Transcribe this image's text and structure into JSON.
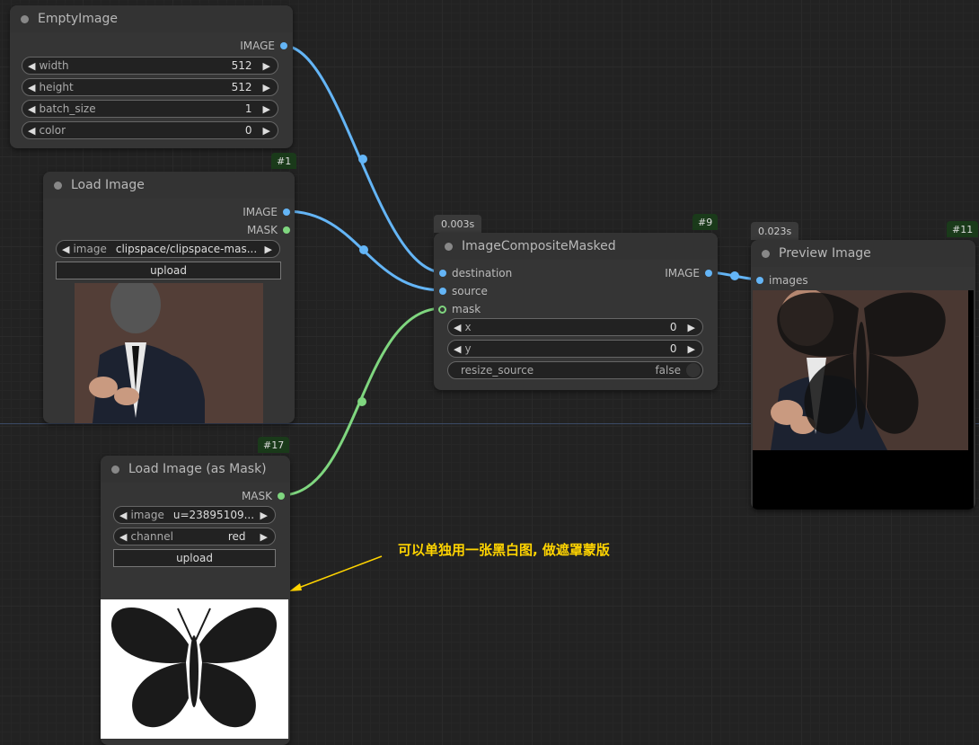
{
  "nodes": {
    "empty_image": {
      "title": "EmptyImage",
      "output_label": "IMAGE",
      "widgets": {
        "width": {
          "label": "width",
          "value": "512"
        },
        "height": {
          "label": "height",
          "value": "512"
        },
        "batch_size": {
          "label": "batch_size",
          "value": "1"
        },
        "color": {
          "label": "color",
          "value": "0"
        }
      }
    },
    "load_image": {
      "id": "#1",
      "title": "Load Image",
      "outputs": [
        "IMAGE",
        "MASK"
      ],
      "image_label": "image",
      "image_value": "clipspace/clipspace-mas...",
      "upload_label": "upload"
    },
    "composite": {
      "id": "#9",
      "timing": "0.003s",
      "title": "ImageCompositeMasked",
      "inputs": [
        "destination",
        "source",
        "mask"
      ],
      "output_label": "IMAGE",
      "widgets": {
        "x": {
          "label": "x",
          "value": "0"
        },
        "y": {
          "label": "y",
          "value": "0"
        },
        "resize_source": {
          "label": "resize_source",
          "value": "false"
        }
      }
    },
    "preview": {
      "id": "#11",
      "timing": "0.023s",
      "title": "Preview Image",
      "input_label": "images"
    },
    "load_mask": {
      "id": "#17",
      "title": "Load Image (as Mask)",
      "output_label": "MASK",
      "image_label": "image",
      "image_value": "u=23895109...",
      "channel_label": "channel",
      "channel_value": "red",
      "upload_label": "upload"
    }
  },
  "annotation": "可以单独用一张黑白图, 做遮罩蒙版",
  "colors": {
    "image_link": "#64b5f6",
    "mask_link": "#7fd67f",
    "annotation": "#ffd400",
    "background": "#222222"
  }
}
